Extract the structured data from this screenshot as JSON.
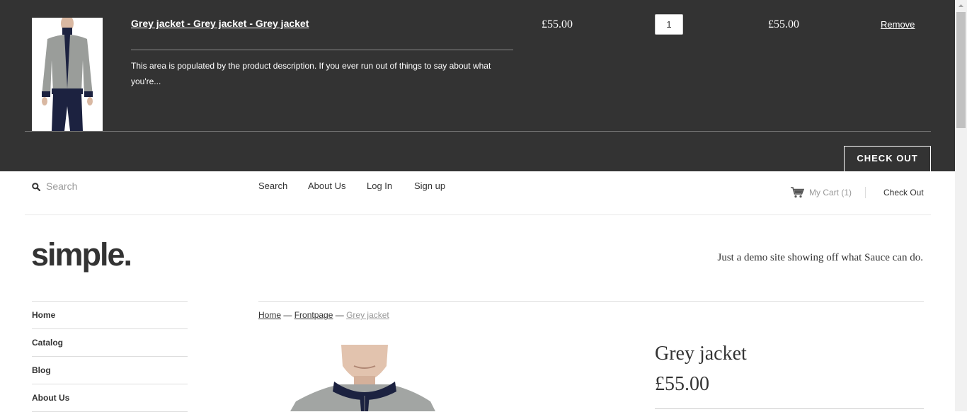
{
  "cart_drawer": {
    "item": {
      "title": "Grey jacket - Grey jacket - Grey jacket",
      "description": "This area is populated by the product description. If you ever run out of things to say about what you're...",
      "price": "£55.00",
      "quantity": "1",
      "line_total": "£55.00",
      "remove_label": "Remove"
    },
    "checkout_label": "CHECK OUT"
  },
  "header": {
    "search_placeholder": "Search",
    "links": [
      "Search",
      "About Us",
      "Log In",
      "Sign up"
    ],
    "my_cart_label": "My Cart (1)",
    "checkout_label": "Check Out"
  },
  "branding": {
    "logo_text": "simple.",
    "tagline": "Just a demo site showing off what Sauce can do."
  },
  "sidebar": {
    "items": [
      "Home",
      "Catalog",
      "Blog",
      "About Us"
    ]
  },
  "breadcrumb": {
    "home": "Home",
    "separator": " — ",
    "collection": "Frontpage",
    "current": "Grey jacket"
  },
  "product": {
    "title": "Grey jacket",
    "price": "£55.00"
  },
  "colors": {
    "drawer_background": "#333333",
    "text": "#333333",
    "muted_text": "#999999"
  },
  "icons": {
    "search": "search-icon",
    "cart": "cart-icon"
  }
}
